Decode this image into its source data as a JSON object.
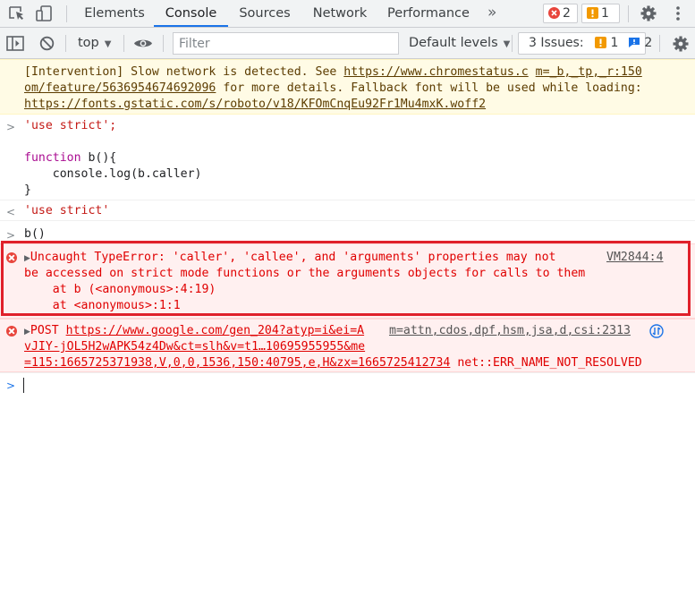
{
  "tabbar": {
    "tabs": [
      {
        "label": "Elements"
      },
      {
        "label": "Console"
      },
      {
        "label": "Sources"
      },
      {
        "label": "Network"
      },
      {
        "label": "Performance"
      }
    ],
    "more_label": "»",
    "errors_count": "2",
    "warnings_count": "1",
    "icons": [
      "inspect-element-icon",
      "device-toolbar-icon",
      "error-icon",
      "warning-icon",
      "gear-icon",
      "kebab-menu-icon"
    ]
  },
  "toolbar": {
    "context": "top",
    "filter_placeholder": "Filter",
    "levels": "Default levels",
    "issues_label": "3 Issues:",
    "issues_warn_count": "1",
    "issues_info_count": "2",
    "icons": [
      "sidebar-toggle-icon",
      "clear-console-icon",
      "eye-icon",
      "gear-icon"
    ]
  },
  "console": {
    "warning": {
      "line1_a": "[Intervention] Slow network is detected. See ",
      "line1_link": "https://www.chromestatus.c",
      "line1_src": "m=_b,_tp,_r:150",
      "line2_link": "om/feature/5636954674692096",
      "line2_b": " for more details. Fallback font will be used while loading:",
      "line3_link": "https://fonts.gstatic.com/s/roboto/v18/KFOmCnqEu92Fr1Mu4mxK.woff2"
    },
    "input1": {
      "line1": "'use strict';",
      "kw": "function",
      "fn_sig": " b(){",
      "line4": "    console.log(b.caller)",
      "line5": "}"
    },
    "result1": "'use strict'",
    "input2": "b()",
    "error1": {
      "line1": "Uncaught TypeError: 'caller', 'callee', and 'arguments' properties may not",
      "source": "VM2844:4",
      "line2": "be accessed on strict mode functions or the arguments objects for calls to them",
      "line3": "    at b (<anonymous>:4:19)",
      "line4": "    at <anonymous>:1:1"
    },
    "error2": {
      "method": "POST ",
      "url1": "https://www.google.com/gen_204?atyp=i&ei=A",
      "source": "m=attn,cdos,dpf,hsm,jsa,d,csi:2313",
      "url2": "vJIY-jOL5H2wAPK54z4Dw&ct=slh&v=t1…10695955955&me",
      "url3": "=115:1665725371938,V,0,0,1536,150:40795,e,H&zx=1665725412734",
      "status": " net::ERR_NAME_NOT_RESOLVED"
    }
  },
  "colors": {
    "accent": "#1a73e8",
    "error": "#e00000",
    "warning_bg": "#fffbe5",
    "error_bg": "#fff0f0",
    "highlight": "#e0202a"
  }
}
